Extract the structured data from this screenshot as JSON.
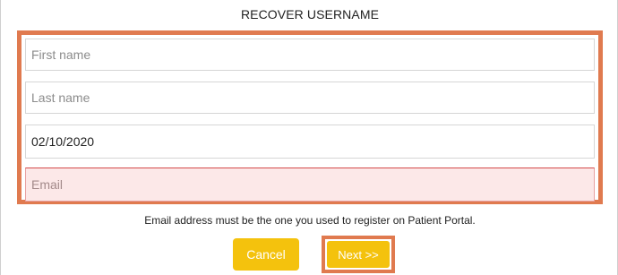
{
  "dialog": {
    "title": "RECOVER USERNAME"
  },
  "form": {
    "first_name": {
      "placeholder": "First name",
      "value": ""
    },
    "last_name": {
      "placeholder": "Last name",
      "value": ""
    },
    "date_of_birth": {
      "value": "02/10/2020"
    },
    "email": {
      "placeholder": "Email",
      "value": ""
    }
  },
  "note": "Email address must be the one you used to register on Patient Portal.",
  "buttons": {
    "cancel_label": "Cancel",
    "next_label": "Next >>"
  },
  "colors": {
    "highlight": "#e07a4f",
    "button": "#f4c20d",
    "error_background": "#fce8e8"
  }
}
